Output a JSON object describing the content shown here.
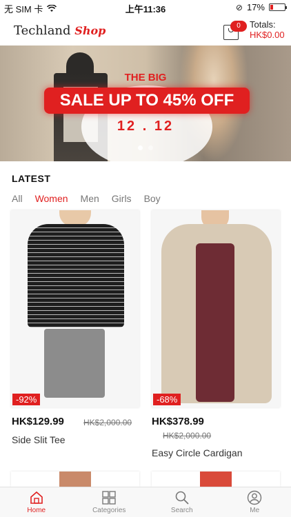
{
  "status_bar": {
    "carrier": "无 SIM 卡",
    "time": "上午11:36",
    "battery": "17%",
    "battery_fraction": 0.17
  },
  "header": {
    "brand": "Techland",
    "brand_accent": "Shop",
    "cart_count": "0",
    "totals_label": "Totals:",
    "totals_amount": "HK$0.00"
  },
  "banner": {
    "line1": "THE BIG",
    "line2": "SALE UP TO 45% OFF",
    "line3": "12 . 12",
    "slide_count": 2,
    "active_slide": 1
  },
  "latest": {
    "title": "LATEST",
    "tabs": [
      "All",
      "Women",
      "Men",
      "Girls",
      "Boy"
    ],
    "active_tab": "Women"
  },
  "products": [
    {
      "name": "Side Slit Tee",
      "price": "HK$129.99",
      "old_price": "HK$2,000.00",
      "discount": "-92%"
    },
    {
      "name": "Easy Circle Cardigan",
      "price": "HK$378.99",
      "old_price": "HK$2,000.00",
      "discount": "-68%"
    }
  ],
  "nav": {
    "items": [
      "Home",
      "Categories",
      "Search",
      "Me"
    ],
    "active": "Home"
  },
  "colors": {
    "accent": "#e02020",
    "text": "#222222",
    "muted": "#777777"
  }
}
